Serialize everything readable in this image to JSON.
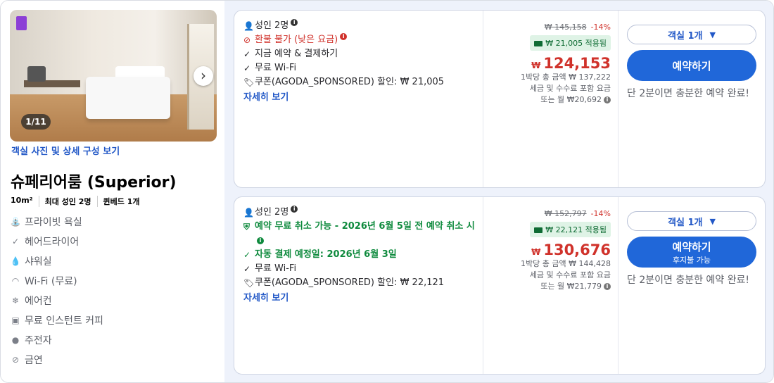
{
  "room": {
    "photo_counter": "1/11",
    "view_photos_link": "객실 사진 및 상세 구성 보기",
    "name": "슈페리어룸 (Superior)",
    "meta": [
      "10m²",
      "최대 성인 2명",
      "퀸베드 1개"
    ],
    "amenities": [
      {
        "icon": "shower-icon",
        "label": "프라이빗 욕실"
      },
      {
        "icon": "check-icon",
        "label": "헤어드라이어"
      },
      {
        "icon": "droplet-icon",
        "label": "샤워실"
      },
      {
        "icon": "wifi-icon",
        "label": "Wi-Fi (무료)"
      },
      {
        "icon": "snowflake-icon",
        "label": "에어컨"
      },
      {
        "icon": "coffee-machine-icon",
        "label": "무료 인스턴트 커피"
      },
      {
        "icon": "parking-icon",
        "label": "주전자"
      },
      {
        "icon": "no-smoking-icon",
        "label": "금연"
      }
    ]
  },
  "offers": [
    {
      "guests": "성인 2명",
      "conditions": [
        {
          "type": "red",
          "icon": "no-entry-icon",
          "text": "환불 불가 (낮은 요금)"
        },
        {
          "type": "normal",
          "icon": "check-icon",
          "text": "지금 예약 & 결제하기"
        },
        {
          "type": "normal",
          "icon": "check-icon",
          "text": "무료 Wi-Fi"
        },
        {
          "type": "normal",
          "icon": "tag-icon",
          "text": "쿠폰(AGODA_SPONSORED) 할인: ₩ 21,005"
        }
      ],
      "more_link": "자세히 보기",
      "old_price": "₩ 145,158",
      "discount": "-14%",
      "coupon_applied": "₩ 21,005 적용됨",
      "currency": "₩",
      "price": "124,153",
      "note_total": "1박당 총 금액 ₩ 137,222",
      "note_tax": "세금 및 수수료 포함 요금",
      "note_monthly": "또는 월 ₩20,692",
      "room_select": "객실 1개",
      "book_label": "예약하기",
      "book_sub": "",
      "urgency": "단 2분이면 충분한 예약 완료!"
    },
    {
      "guests": "성인 2명",
      "conditions": [
        {
          "type": "green",
          "icon": "shield-icon",
          "text": "예약 무료 취소 가능 - 2026년 6월 5일 전 예약 취소 시"
        },
        {
          "type": "green",
          "icon": "check-icon",
          "text": "자동 결제 예정일: 2026년 6월 3일"
        },
        {
          "type": "normal",
          "icon": "check-icon",
          "text": "무료 Wi-Fi"
        },
        {
          "type": "normal",
          "icon": "tag-icon",
          "text": "쿠폰(AGODA_SPONSORED) 할인: ₩ 22,121"
        }
      ],
      "more_link": "자세히 보기",
      "old_price": "₩ 152,797",
      "discount": "-14%",
      "coupon_applied": "₩ 22,121 적용됨",
      "currency": "₩",
      "price": "130,676",
      "note_total": "1박당 총 금액 ₩ 144,428",
      "note_tax": "세금 및 수수료 포함 요금",
      "note_monthly": "또는 월 ₩21,779",
      "room_select": "객실 1개",
      "book_label": "예약하기",
      "book_sub": "후지불 가능",
      "urgency": "단 2분이면 충분한 예약 완료!"
    }
  ]
}
